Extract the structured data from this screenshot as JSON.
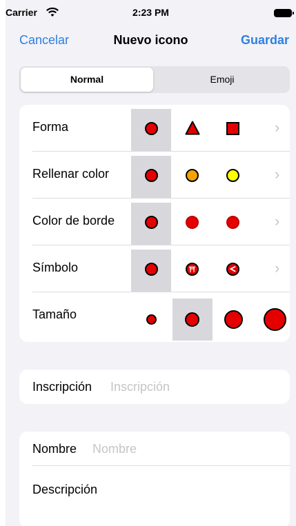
{
  "status_bar": {
    "carrier": "Carrier",
    "time": "2:23 PM"
  },
  "nav": {
    "cancel": "Cancelar",
    "title": "Nuevo icono",
    "save": "Guardar",
    "accent_color": "#2f7fe0"
  },
  "segmented": {
    "options": [
      "Normal",
      "Emoji"
    ],
    "selected": "Normal"
  },
  "options": {
    "forma": {
      "label": "Forma",
      "choices": [
        "circle",
        "triangle",
        "square"
      ],
      "selected": "circle"
    },
    "rellenar_color": {
      "label": "Rellenar color",
      "choices": [
        "#e50000",
        "#f5a300",
        "#ffff00"
      ],
      "selected": "#e50000"
    },
    "color_de_borde": {
      "label": "Color de borde",
      "choices": [
        "#000000",
        "#e50000",
        "#e50000"
      ],
      "selected": "#000000"
    },
    "simbolo": {
      "label": "Símbolo",
      "choices": [
        "none",
        "symbol-a",
        "symbol-b"
      ],
      "selected": "none"
    },
    "tamano": {
      "label": "Tamaño",
      "choices": [
        "small",
        "medium",
        "large",
        "extra-large"
      ],
      "selected": "medium"
    }
  },
  "inscription": {
    "label": "Inscripción",
    "placeholder": "Inscripción",
    "value": ""
  },
  "name": {
    "label": "Nombre",
    "placeholder": "Nombre",
    "value": ""
  },
  "description": {
    "label": "Descripción"
  },
  "colors": {
    "red": "#e50000",
    "orange": "#f5a300",
    "yellow": "#ffff00",
    "selected_bg": "#d8d8dc"
  }
}
